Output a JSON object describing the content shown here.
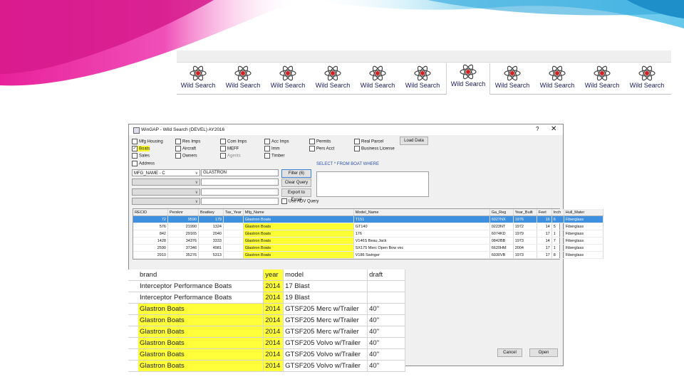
{
  "colors": {
    "highlight": "#ffff33",
    "selection": "#3d8fe0",
    "swoosh_magenta": "#e8219b",
    "swoosh_blue": "#4fc3ea"
  },
  "tabs": {
    "label": "Wild Search",
    "icon": "atom-icon",
    "count": 11,
    "active_index": 6
  },
  "dialog": {
    "title": "WinGAP - Wild Search (DEVEL) AY2016",
    "help": "?",
    "close": "✕",
    "checkboxes": {
      "mfg_housing": "Mfg Housing",
      "boats": "Boats",
      "sales": "Sales",
      "address": "Address",
      "res_imps": "Res Imps",
      "aircraft": "Aircraft",
      "owners": "Owners",
      "com_imps": "Com Imps",
      "meff": "MEFF",
      "agents": "Agents",
      "acc_imps": "Acc Imps",
      "imm": "Imm",
      "timber": "Timber",
      "permits": "Permits",
      "pers_acct": "Pers Acct",
      "real_parcel": "Real Parcel",
      "business_license": "Business License"
    },
    "boats_checked": "✓",
    "load_data": "Load Data",
    "field_select": "MFG_NAME - C",
    "field_value": "GLASTRON",
    "filter_button": "Filter (6)",
    "clear_query": "Clear Query",
    "export_excel": "Export to Excel",
    "use_adv_query": "Use ADV Query",
    "sql_text": "SELECT * FROM BOAT WHERE",
    "cancel": "Cancel",
    "open": "Open",
    "grid": {
      "columns": [
        "RECID",
        "Persknr",
        "Boatkey",
        "Tax_Year",
        "Mfg_Name",
        "Model_Name",
        "Ga_Reg",
        "Year_Built",
        "Feet",
        "Inch",
        "Hull_Mater"
      ],
      "rows": [
        [
          "72",
          "9590",
          "179",
          "",
          "Glastron Boats",
          "T151",
          "6027NX",
          "1976",
          "16",
          "6",
          "Fiberglass"
        ],
        [
          "576",
          "21990",
          "1324",
          "",
          "Glastron Boats",
          "GT140",
          "0223NT",
          "1972",
          "14",
          "5",
          "Fiberglass"
        ],
        [
          "842",
          "29165",
          "2040",
          "",
          "Glastron Boats",
          "176",
          "6074KD",
          "1979",
          "17",
          "1",
          "Fiberglass"
        ],
        [
          "1428",
          "34376",
          "3333",
          "",
          "Glastron Boats",
          "V146S Beau Jack",
          "0842BB",
          "1973",
          "14",
          "7",
          "Fiberglass"
        ],
        [
          "2590",
          "37346",
          "4981",
          "",
          "Glastron Boats",
          "SX175 Merc Open Bow vec",
          "6620HM",
          "2004",
          "17",
          "1",
          "Fiberglass"
        ],
        [
          "2910",
          "35276",
          "5313",
          "",
          "Glastron Boats",
          "V186 Swinger",
          "6030VB",
          "1973",
          "17",
          "8",
          "Fiberglass"
        ]
      ]
    }
  },
  "sheet": {
    "headers": [
      "brand",
      "year",
      "model",
      "draft"
    ],
    "rows": [
      [
        "Interceptor Performance Boats",
        "2014",
        "17 Blast",
        ""
      ],
      [
        "Interceptor Performance Boats",
        "2014",
        "19 Blast",
        ""
      ],
      [
        "Glastron Boats",
        "2014",
        "GTSF205 Merc w/Trailer",
        "40\""
      ],
      [
        "Glastron Boats",
        "2014",
        "GTSF205 Merc w/Trailer",
        "40\""
      ],
      [
        "Glastron Boats",
        "2014",
        "GTSF205 Merc w/Trailer",
        "40\""
      ],
      [
        "Glastron Boats",
        "2014",
        "GTSF205 Volvo w/Trailer",
        "40\""
      ],
      [
        "Glastron Boats",
        "2014",
        "GTSF205 Volvo w/Trailer",
        "40\""
      ],
      [
        "Glastron Boats",
        "2014",
        "GTSF205 Volvo w/Trailer",
        "40\""
      ]
    ]
  }
}
